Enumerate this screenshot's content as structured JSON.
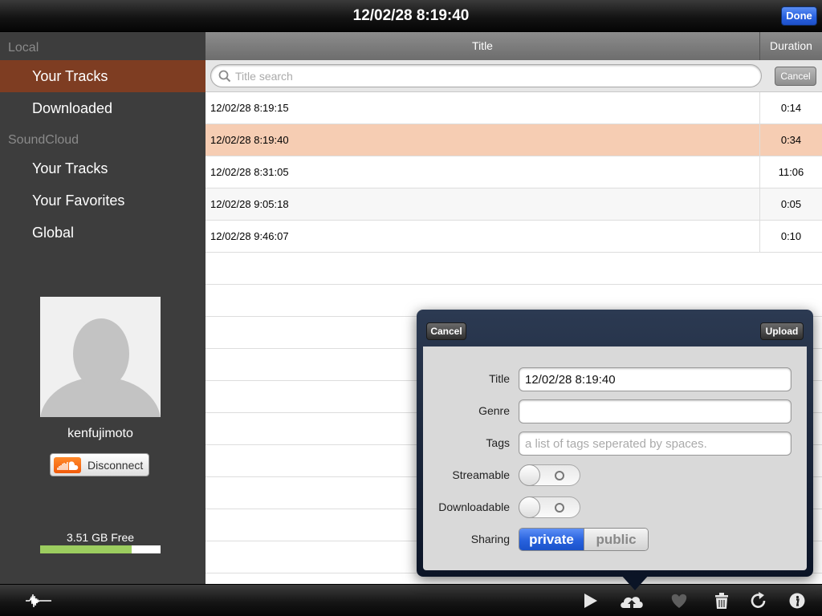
{
  "topbar": {
    "title": "12/02/28 8:19:40",
    "done_label": "Done"
  },
  "sidebar": {
    "local_header": "Local",
    "local_items": [
      "Your Tracks",
      "Downloaded"
    ],
    "soundcloud_header": "SoundCloud",
    "sc_items": [
      "Your Tracks",
      "Your Favorites",
      "Global"
    ],
    "username": "kenfujimoto",
    "disconnect_label": "Disconnect",
    "storage_label": "3.51 GB Free",
    "storage_used_fraction": 0.76
  },
  "table": {
    "col_title": "Title",
    "col_duration": "Duration",
    "search_placeholder": "Title search",
    "search_cancel": "Cancel",
    "rows": [
      {
        "title": "12/02/28 8:19:15",
        "duration": "0:14"
      },
      {
        "title": "12/02/28 8:19:40",
        "duration": "0:34"
      },
      {
        "title": "12/02/28 8:31:05",
        "duration": "11:06"
      },
      {
        "title": "12/02/28 9:05:18",
        "duration": "0:05"
      },
      {
        "title": "12/02/28 9:46:07",
        "duration": "0:10"
      }
    ]
  },
  "upload_form": {
    "cancel_label": "Cancel",
    "upload_label": "Upload",
    "title_label": "Title",
    "title_value": "12/02/28 8:19:40",
    "genre_label": "Genre",
    "genre_value": "",
    "tags_label": "Tags",
    "tags_placeholder": "a list of tags seperated by spaces.",
    "streamable_label": "Streamable",
    "downloadable_label": "Downloadable",
    "sharing_label": "Sharing",
    "sharing_private": "private",
    "sharing_public": "public"
  },
  "toolbar": {
    "icons": [
      "waveform-icon",
      "play-icon",
      "cloud-upload-icon",
      "heart-icon",
      "trash-icon",
      "refresh-icon",
      "info-icon"
    ]
  },
  "colors": {
    "sidebar_active": "#7e3d22",
    "selected_row": "#f6cdb3",
    "accent_blue": "#2a62df",
    "storage_green": "#9ccd5f"
  }
}
